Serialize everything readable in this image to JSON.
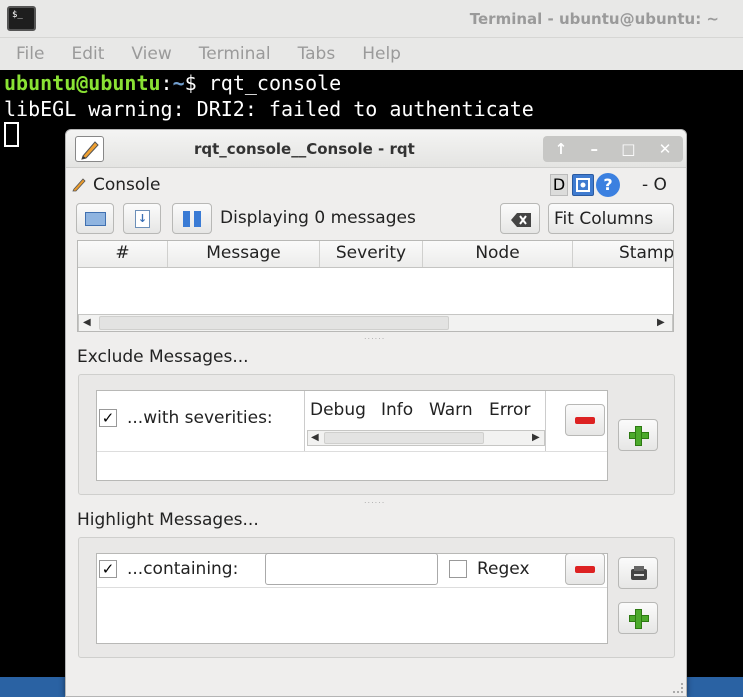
{
  "terminal": {
    "title": "Terminal - ubuntu@ubuntu: ~",
    "menu": [
      "File",
      "Edit",
      "View",
      "Terminal",
      "Tabs",
      "Help"
    ],
    "prompt_user": "ubuntu@ubuntu",
    "prompt_sep": ":",
    "prompt_path": "~",
    "prompt_sym": "$ ",
    "command": "rqt_console",
    "output_line": "libEGL warning: DRI2: failed to authenticate"
  },
  "rqt": {
    "title": "rqt_console__Console - rqt",
    "window_controls": [
      "↑",
      "–",
      "□",
      "✕"
    ],
    "plugin_label": "Console",
    "plugin_ctrl_d": "D",
    "plugin_ctrl_dash": "- O",
    "displaying_text": "Displaying 0 messages",
    "fit_columns_label": "Fit Columns",
    "columns": [
      "#",
      "Message",
      "Severity",
      "Node",
      "Stamp"
    ],
    "exclude_label": "Exclude Messages...",
    "exclude_with_severities": "...with severities:",
    "severities": [
      "Debug",
      "Info",
      "Warn",
      "Error"
    ],
    "exclude_checked": "✓",
    "highlight_label": "Highlight Messages...",
    "highlight_containing": "...containing:",
    "highlight_checked": "✓",
    "regex_label": "Regex",
    "highlight_input_value": ""
  },
  "icons": [
    "terminal-icon",
    "pencil-icon",
    "open-folder-icon",
    "save-icon",
    "pause-icon",
    "clear-icon",
    "remove-icon",
    "add-icon",
    "save-filter-icon",
    "help-icon",
    "settings-icon"
  ]
}
